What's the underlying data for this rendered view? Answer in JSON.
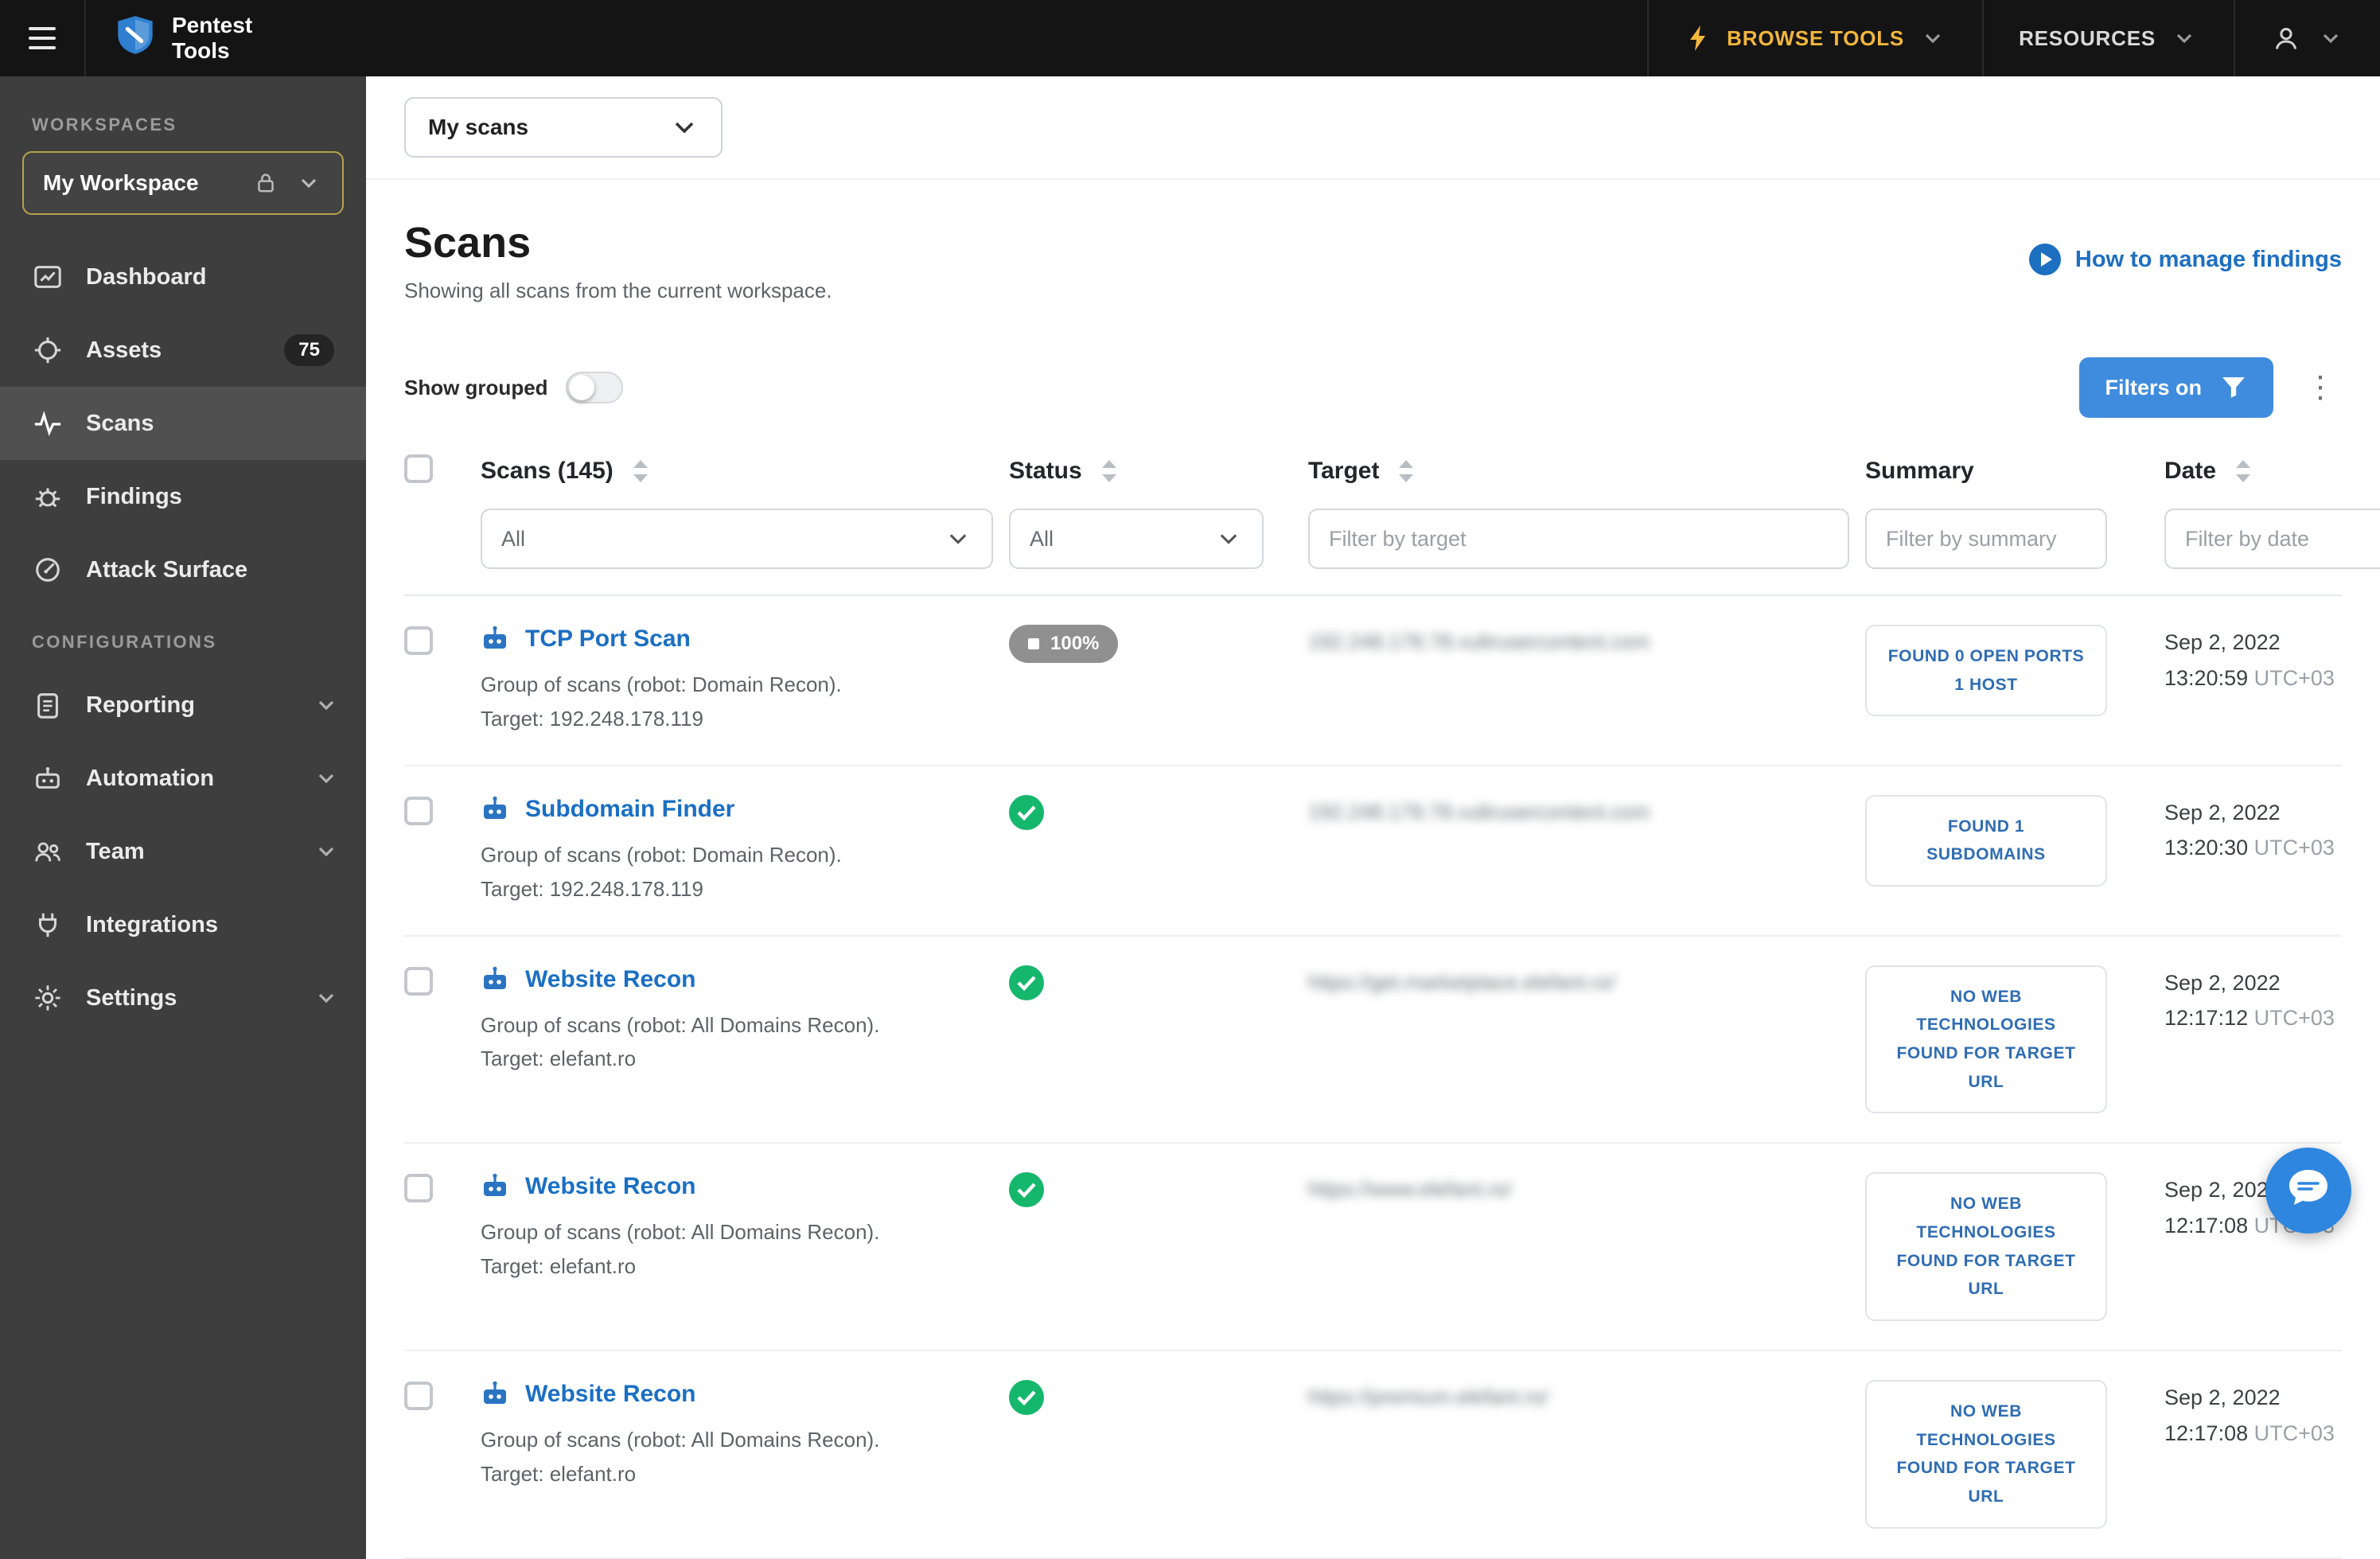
{
  "topbar": {
    "logo_line1": "Pentest",
    "logo_line2": "Tools",
    "browse_tools_label": "BROWSE TOOLS",
    "resources_label": "RESOURCES"
  },
  "sidebar": {
    "workspaces_label": "WORKSPACES",
    "workspace_name": "My Workspace",
    "nav": [
      {
        "label": "Dashboard"
      },
      {
        "label": "Assets",
        "badge": "75"
      },
      {
        "label": "Scans"
      },
      {
        "label": "Findings"
      },
      {
        "label": "Attack Surface"
      }
    ],
    "configurations_label": "CONFIGURATIONS",
    "config": [
      {
        "label": "Reporting"
      },
      {
        "label": "Automation"
      },
      {
        "label": "Team"
      },
      {
        "label": "Integrations"
      },
      {
        "label": "Settings"
      }
    ]
  },
  "main": {
    "scope_selector_value": "My scans",
    "title": "Scans",
    "subtitle": "Showing all scans from the current workspace.",
    "help_link_label": "How to manage findings",
    "show_grouped_label": "Show grouped",
    "filters_button_label": "Filters on",
    "table": {
      "headers": [
        "Scans (145)",
        "Status",
        "Target",
        "Summary",
        "Date"
      ],
      "filter_scans_value": "All",
      "filter_status_value": "All",
      "filter_target_placeholder": "Filter by target",
      "filter_summary_placeholder": "Filter by summary",
      "filter_date_placeholder": "Filter by date",
      "rows": [
        {
          "title": "TCP Port Scan",
          "description": "Group of scans (robot: Domain Recon).",
          "target_line": "Target: 192.248.178.119",
          "status_label": "100%",
          "target": "192.248.178.78.vultrusercontent.com",
          "summary": [
            "FOUND 0 OPEN PORTS",
            "1 HOST"
          ],
          "date": "Sep 2, 2022",
          "time": "13:20:59",
          "tz": "UTC+03"
        },
        {
          "title": "Subdomain Finder",
          "description": "Group of scans (robot: Domain Recon).",
          "target_line": "Target: 192.248.178.119",
          "target": "192.248.178.78.vultrusercontent.com",
          "summary": [
            "FOUND 1",
            "SUBDOMAINS"
          ],
          "date": "Sep 2, 2022",
          "time": "13:20:30",
          "tz": "UTC+03"
        },
        {
          "title": "Website Recon",
          "description": "Group of scans (robot: All Domains Recon).",
          "target_line": "Target: elefant.ro",
          "target": "https://get.marketplace.elefant.ro/",
          "summary": [
            "NO WEB",
            "TECHNOLOGIES",
            "FOUND FOR TARGET",
            "URL"
          ],
          "date": "Sep 2, 2022",
          "time": "12:17:12",
          "tz": "UTC+03"
        },
        {
          "title": "Website Recon",
          "description": "Group of scans (robot: All Domains Recon).",
          "target_line": "Target: elefant.ro",
          "target": "https://www.elefant.ro/",
          "summary": [
            "NO WEB",
            "TECHNOLOGIES",
            "FOUND FOR TARGET",
            "URL"
          ],
          "date": "Sep 2, 2022",
          "time": "12:17:08",
          "tz": "UTC+03"
        },
        {
          "title": "Website Recon",
          "description": "Group of scans (robot: All Domains Recon).",
          "target_line": "Target: elefant.ro",
          "target": "https://premium.elefant.ro/",
          "summary": [
            "NO WEB",
            "TECHNOLOGIES",
            "FOUND FOR TARGET",
            "URL"
          ],
          "date": "Sep 2, 2022",
          "time": "12:17:08",
          "tz": "UTC+03"
        }
      ]
    }
  }
}
